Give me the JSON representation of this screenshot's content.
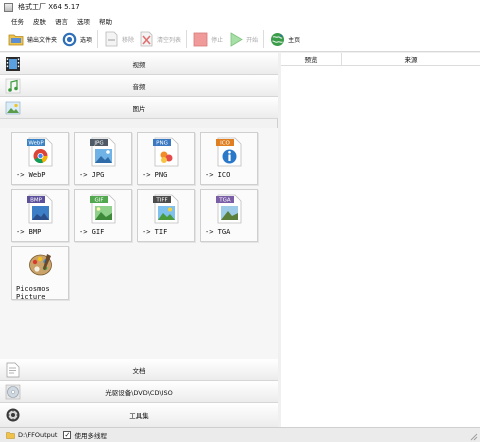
{
  "window": {
    "title": "格式工厂 X64 5.17"
  },
  "menu": [
    "任务",
    "皮肤",
    "语言",
    "选项",
    "帮助"
  ],
  "toolbar": {
    "output_folder": "输出文件夹",
    "options": "选项",
    "remove": "移除",
    "clear_list": "清空列表",
    "stop": "停止",
    "start": "开始",
    "home": "主页"
  },
  "categories": {
    "video": "视频",
    "audio": "音频",
    "image": "图片",
    "document": "文档",
    "optical": "光驱设备\\DVD\\CD\\ISO",
    "tools": "工具集"
  },
  "image_formats": [
    {
      "badge": "WebP",
      "label": "-> WebP",
      "color": "#3c83c6"
    },
    {
      "badge": "JPG",
      "label": "-> JPG",
      "color": "#4e5a66"
    },
    {
      "badge": "PNG",
      "label": "-> PNG",
      "color": "#3a79c2"
    },
    {
      "badge": "ICO",
      "label": "-> ICO",
      "color": "#e07f22"
    },
    {
      "badge": "BMP",
      "label": "-> BMP",
      "color": "#5c4f9c"
    },
    {
      "badge": "GIF",
      "label": "-> GIF",
      "color": "#52a84e"
    },
    {
      "badge": "TIFF",
      "label": "-> TIF",
      "color": "#4d4d4d"
    },
    {
      "badge": "TGA",
      "label": "-> TGA",
      "color": "#7a5fa8"
    }
  ],
  "picosmos": {
    "label": "Picosmos\nPicture"
  },
  "task_table": {
    "col_preview": "预览",
    "col_source": "来源"
  },
  "status": {
    "output_path": "D:\\FFOutput",
    "multithread_label": "使用多线程",
    "multithread_checked": true
  }
}
